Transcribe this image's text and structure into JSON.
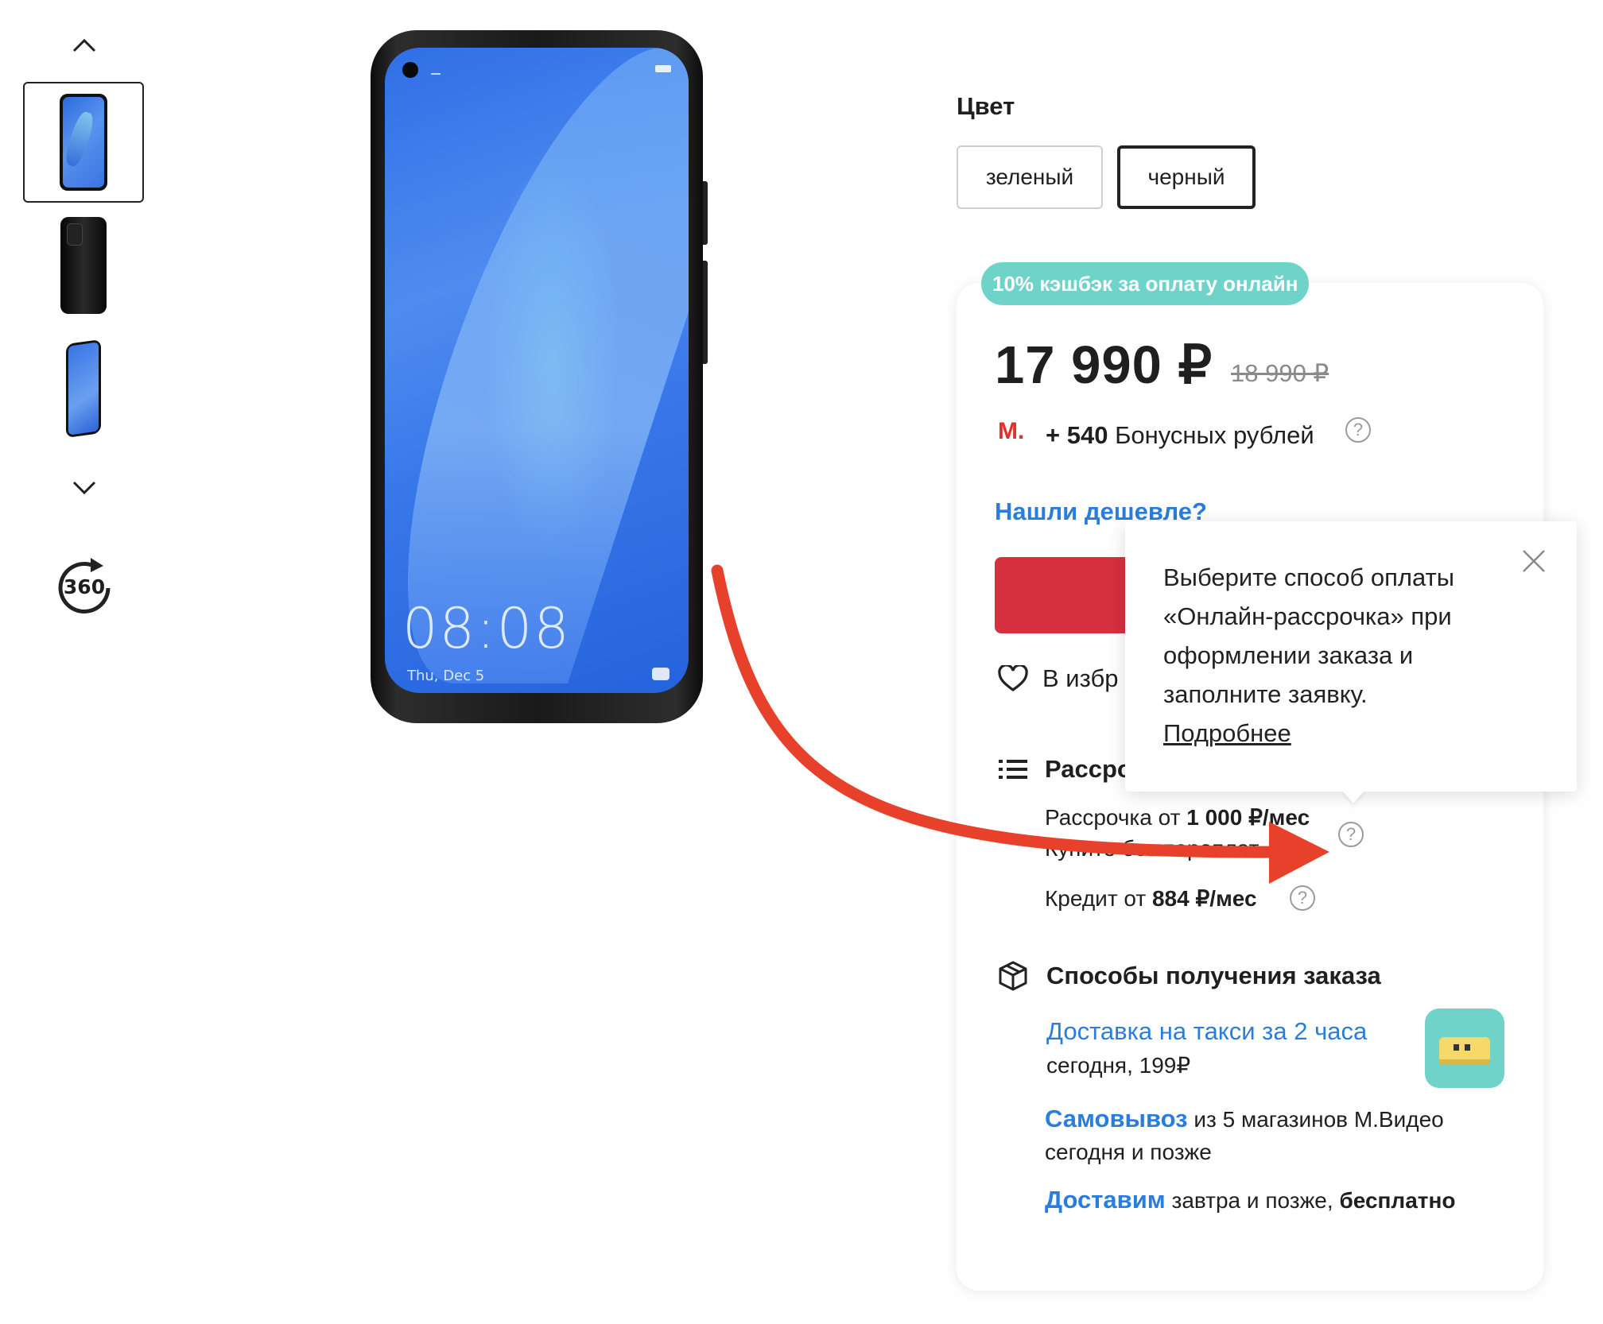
{
  "gallery": {
    "up_icon": "chevron-up-icon",
    "down_icon": "chevron-down-icon",
    "view360_label": "360"
  },
  "phone_screen": {
    "time": "08:08",
    "date": "Thu, Dec 5"
  },
  "color": {
    "title": "Цвет",
    "options": [
      "зеленый",
      "черный"
    ],
    "selected": "черный"
  },
  "offer": {
    "cashback_badge": "10% кэшбэк за оплату онлайн",
    "price": "17 990 ₽",
    "old_price": "18 990 ₽",
    "bonus_logo": "M.",
    "bonus_amount": "+ 540",
    "bonus_text": "Бонусных рублей",
    "found_cheaper": "Нашли дешевле?",
    "favorite_label": "В избр"
  },
  "installment": {
    "title": "Рассро",
    "line1_prefix": "Рассрочка от ",
    "line1_amount": "1 000 ₽/мес",
    "line2": "Купите без переплат",
    "credit_prefix": "Кредит от ",
    "credit_amount": "884 ₽/мес"
  },
  "delivery": {
    "title": "Способы получения заказа",
    "taxi_link": "Доставка на такси за 2 часа",
    "taxi_sub": "сегодня, 199₽",
    "pickup_link": "Самовывоз",
    "pickup_text": " из 5 магазинов М.Видео",
    "pickup_sub": "сегодня и позже",
    "deliver_link": "Доставим",
    "deliver_text": " завтра и позже, ",
    "deliver_free": "бесплатно"
  },
  "tooltip": {
    "lines": [
      "Выберите способ оплаты",
      "«Онлайн-рассрочка» при",
      "оформлении заказа и",
      "заполните заявку."
    ],
    "more_link": "Подробнее"
  },
  "colors": {
    "accent_red": "#d6303f",
    "link_blue": "#2a7ddc",
    "cashback_teal": "#6fd3c9",
    "arrow_red": "#e8412b"
  }
}
